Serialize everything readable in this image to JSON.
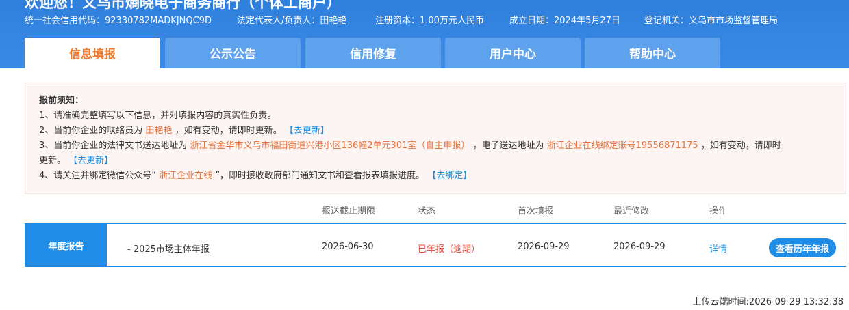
{
  "header": {
    "welcome": "欢迎您！义乌市熵晓电子商务商行（个体工商户）",
    "credit_code": "统一社会信用代码：92330782MADKJNQC9D",
    "legal_rep": "法定代表人/负责人：田艳艳",
    "capital": "注册资本：1.00万元人民币",
    "founded": "成立日期：2024年5月27日",
    "authority": "登记机关：义乌市市场监督管理局"
  },
  "tabs": [
    {
      "label": "信息填报",
      "active": true
    },
    {
      "label": "公示公告",
      "active": false
    },
    {
      "label": "信用修复",
      "active": false
    },
    {
      "label": "用户中心",
      "active": false
    },
    {
      "label": "帮助中心",
      "active": false
    }
  ],
  "notice": {
    "title": "报前须知：",
    "line1": "1、请准确完整填写以下信息，并对填报内容的真实性负责。",
    "line2_a": "2、当前你企业的联络员为",
    "line2_contact": "田艳艳",
    "line2_b": "，如有变动，请即时更新。",
    "line2_link": "【去更新】",
    "line3_a": "3、当前你企业的法律文书送达地址为",
    "line3_addr": "浙江省金华市义乌市福田街道兴港小区136幢2单元301室（自主申报）",
    "line3_b": "，电子送达地址为",
    "line3_eaddr": "浙江企业在线绑定账号19556871175",
    "line3_c": "，如有变动，请即时",
    "line3_d": "更新。",
    "line3_link": "【去更新】",
    "line4_a": "4、请关注并绑定微信公众号“",
    "line4_wechat": "浙江企业在线",
    "line4_b": "”，即时接收政府部门通知文书和查看报表填报进度。",
    "line4_link": "【去绑定】"
  },
  "table": {
    "headers": {
      "deadline": "报送截止期限",
      "status": "状态",
      "first_fill": "首次填报",
      "last_modified": "最近修改",
      "action": "操作"
    },
    "row": {
      "label": "年度报告",
      "name": "- 2025市场主体年报",
      "deadline": "2026-06-30",
      "status": "已年报（逾期）",
      "first_fill": "2026-09-29",
      "last_modified": "2026-09-29",
      "detail": "详情",
      "history_button": "查看历年年报"
    }
  },
  "upload_time": "上传云端时间:2026-09-29 13:32:38",
  "colors": {
    "header_blue": "#3a8ae6",
    "tab_inactive": "#5ea1ec",
    "accent_orange": "#f0792a",
    "link_blue": "#1a8de0",
    "overdue_red": "#e04a3a"
  }
}
